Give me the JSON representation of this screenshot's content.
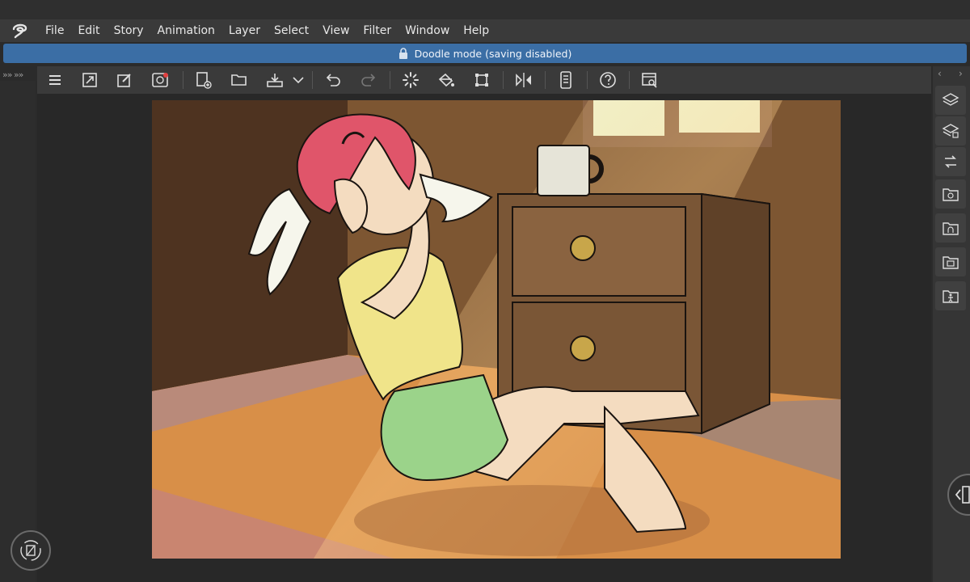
{
  "menu": [
    "File",
    "Edit",
    "Story",
    "Animation",
    "Layer",
    "Select",
    "View",
    "Filter",
    "Window",
    "Help"
  ],
  "notice": {
    "text": "Doodle mode (saving disabled)"
  },
  "left_panel": {
    "collapse_glyph": "»» »»"
  },
  "right_panel": {
    "collapse_left": "‹",
    "collapse_right": "›"
  },
  "toolbar_icons": [
    "menu-icon",
    "resize-canvas-icon",
    "edit-icon",
    "spiral-cloud-icon",
    "new-page-icon",
    "open-folder-icon",
    "export-icon",
    "dropdown-arrow-icon",
    "undo-icon",
    "redo-icon",
    "loading-icon",
    "fill-icon",
    "transform-icon",
    "flip-horizontal-icon",
    "device-icon",
    "help-icon",
    "view-search-icon"
  ],
  "right_icons": [
    "layers-icon",
    "layer-properties-icon",
    "navigator-icon",
    "material-icon",
    "material-people-icon",
    "material-image-icon",
    "material-pose-icon"
  ],
  "colors": {
    "accent_notice": "#3b6ea5",
    "menubar": "#3a3a3a",
    "canvas_wall": "#6b4a2e",
    "hair": "#e0556a",
    "shirt": "#f0e48a",
    "shorts": "#9bd38a",
    "skin": "#f4dcc0",
    "dresser": "#7a5636",
    "floor": "#d88f48"
  }
}
